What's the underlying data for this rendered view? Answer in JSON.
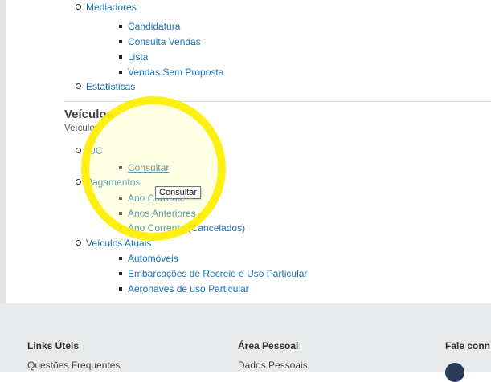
{
  "menu": {
    "mediadores_label": "Mediadores",
    "mediadores_items": [
      "Candidatura",
      "Consulta Vendas",
      "Lista",
      "Vendas Sem Proposta"
    ],
    "estatisticas_label": "Estatísticas"
  },
  "veiculos": {
    "title": "Veículos",
    "subtitle": "Veículos",
    "iuc_label": "IUC",
    "iuc_items": [
      "Consultar"
    ],
    "pagamentos_label": "Pagamentos",
    "pagamentos_items": [
      "Ano Corrente",
      "Anos Anteriores",
      "Ano Corrente (Cancelados)"
    ],
    "atuais_label": "Veículos Atuais",
    "atuais_items": [
      "Automóveis",
      "Embarcações de Recreio e Uso Particular",
      "Aeronaves de uso Particular"
    ]
  },
  "tooltip": "Consultar",
  "footer": {
    "links_title": "Links Úteis",
    "links_first": "Questões Frequentes",
    "area_title": "Área Pessoal",
    "area_first": "Dados Pessoais",
    "contact_title": "Fale conn"
  },
  "colors": {
    "link": "#1a73b8",
    "highlight": "#ffee00",
    "footer_bg": "#e9eaec"
  }
}
